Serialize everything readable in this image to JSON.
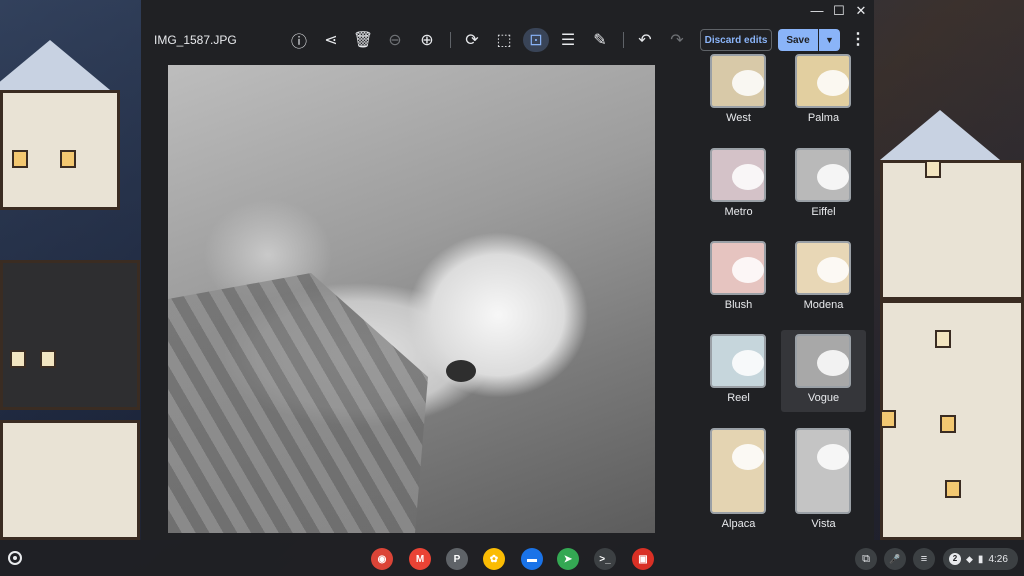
{
  "window": {
    "filename": "IMG_1587.JPG",
    "controls": {
      "minimize": "—",
      "maximize": "☐",
      "close": "✕"
    }
  },
  "toolbar": {
    "tools": [
      {
        "name": "info-icon",
        "glyph": "ⓘ"
      },
      {
        "name": "share-icon",
        "glyph": "⋖"
      },
      {
        "name": "delete-icon",
        "glyph": "🗑"
      },
      {
        "name": "zoom-out-icon",
        "glyph": "⊖"
      },
      {
        "name": "zoom-in-icon",
        "glyph": "⊕"
      },
      {
        "name": "rotate-icon",
        "glyph": "⟳"
      },
      {
        "name": "crop-icon",
        "glyph": "⬚"
      },
      {
        "name": "rescale-icon",
        "glyph": "⊡"
      },
      {
        "name": "adjust-icon",
        "glyph": "☰"
      },
      {
        "name": "annotate-icon",
        "glyph": "✎"
      },
      {
        "name": "undo-icon",
        "glyph": "↶"
      },
      {
        "name": "redo-icon",
        "glyph": "↷"
      }
    ],
    "discard_label": "Discard edits",
    "save_label": "Save",
    "save_menu_glyph": "▼",
    "more_glyph": "⋮"
  },
  "filters": {
    "selected": "Vogue",
    "items": [
      {
        "label": "West",
        "tint": "#d8c9a8"
      },
      {
        "label": "Palma",
        "tint": "#e2cfa0"
      },
      {
        "label": "Metro",
        "tint": "#d4c2c8"
      },
      {
        "label": "Eiffel",
        "tint": "#b9b9b9"
      },
      {
        "label": "Blush",
        "tint": "#e6c4c0"
      },
      {
        "label": "Modena",
        "tint": "#e8d7b6"
      },
      {
        "label": "Reel",
        "tint": "#c6d6dc"
      },
      {
        "label": "Vogue",
        "tint": "#a8a8a8"
      },
      {
        "label": "Alpaca",
        "tint": "#e4d4b2"
      },
      {
        "label": "Vista",
        "tint": "#c4c4c4"
      }
    ]
  },
  "shelf": {
    "apps": [
      {
        "name": "chrome-icon",
        "glyph": "◉",
        "color": "#db4437"
      },
      {
        "name": "gmail-icon",
        "glyph": "M",
        "color": "#ea4335"
      },
      {
        "name": "p-app-icon",
        "glyph": "P",
        "color": "#5f6368"
      },
      {
        "name": "photos-icon",
        "glyph": "✿",
        "color": "#fbbc04"
      },
      {
        "name": "files-icon",
        "glyph": "▬",
        "color": "#1a73e8"
      },
      {
        "name": "send-icon",
        "glyph": "➤",
        "color": "#34a853"
      },
      {
        "name": "terminal-icon",
        "glyph": ">_",
        "color": "#3c4043"
      },
      {
        "name": "gallery-icon",
        "glyph": "▣",
        "color": "#d93025"
      }
    ],
    "tray": {
      "screenshot_glyph": "⧉",
      "mic_glyph": "🎤",
      "playlist_glyph": "≡",
      "notifications": "2",
      "wifi_glyph": "◆",
      "battery_glyph": "▮",
      "time": "4:26"
    }
  }
}
